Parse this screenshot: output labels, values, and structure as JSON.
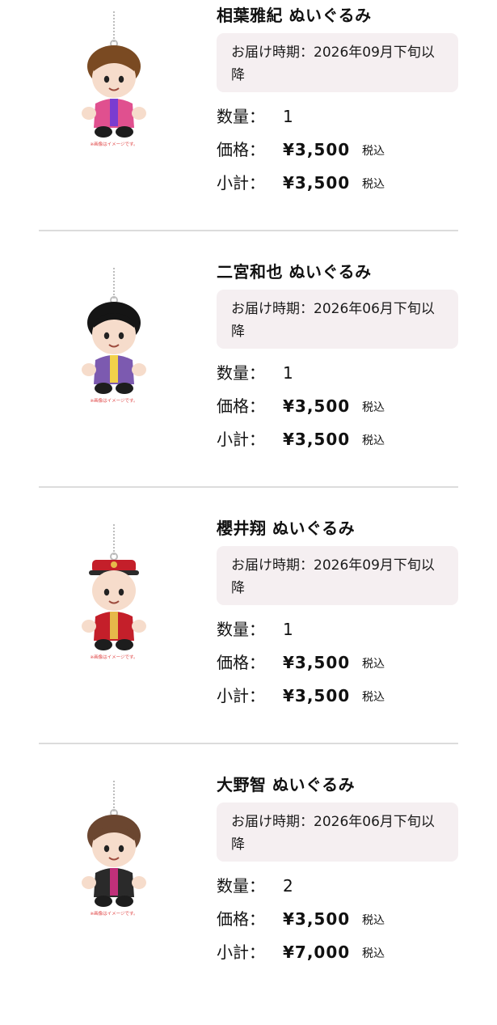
{
  "labels": {
    "quantity": "数量：",
    "price": "価格：",
    "subtotal": "小計：",
    "tax": "税込"
  },
  "image_note": "※画像はイメージです。",
  "items": [
    {
      "name": "相葉雅紀 ぬいぐるみ",
      "delivery": "お届け時期：2026年09月下旬以降",
      "quantity": "1",
      "price": "¥3,500",
      "subtotal": "¥3,500",
      "plush": {
        "hair": "#7a4a22",
        "outfit": "#e0508f",
        "accent": "#7a3cd0"
      }
    },
    {
      "name": "二宮和也 ぬいぐるみ",
      "delivery": "お届け時期：2026年06月下旬以降",
      "quantity": "1",
      "price": "¥3,500",
      "subtotal": "¥3,500",
      "plush": {
        "hair": "#151515",
        "outfit": "#7c5ab0",
        "accent": "#f2d14a"
      }
    },
    {
      "name": "櫻井翔 ぬいぐるみ",
      "delivery": "お届け時期：2026年09月下旬以降",
      "quantity": "1",
      "price": "¥3,500",
      "subtotal": "¥3,500",
      "plush": {
        "hair": "#c41f2a",
        "outfit": "#c41f2a",
        "accent": "#e6b94a"
      }
    },
    {
      "name": "大野智 ぬいぐるみ",
      "delivery": "お届け時期：2026年06月下旬以降",
      "quantity": "2",
      "price": "¥3,500",
      "subtotal": "¥7,000",
      "plush": {
        "hair": "#6b4630",
        "outfit": "#2a2a2a",
        "accent": "#c0307a"
      }
    }
  ]
}
